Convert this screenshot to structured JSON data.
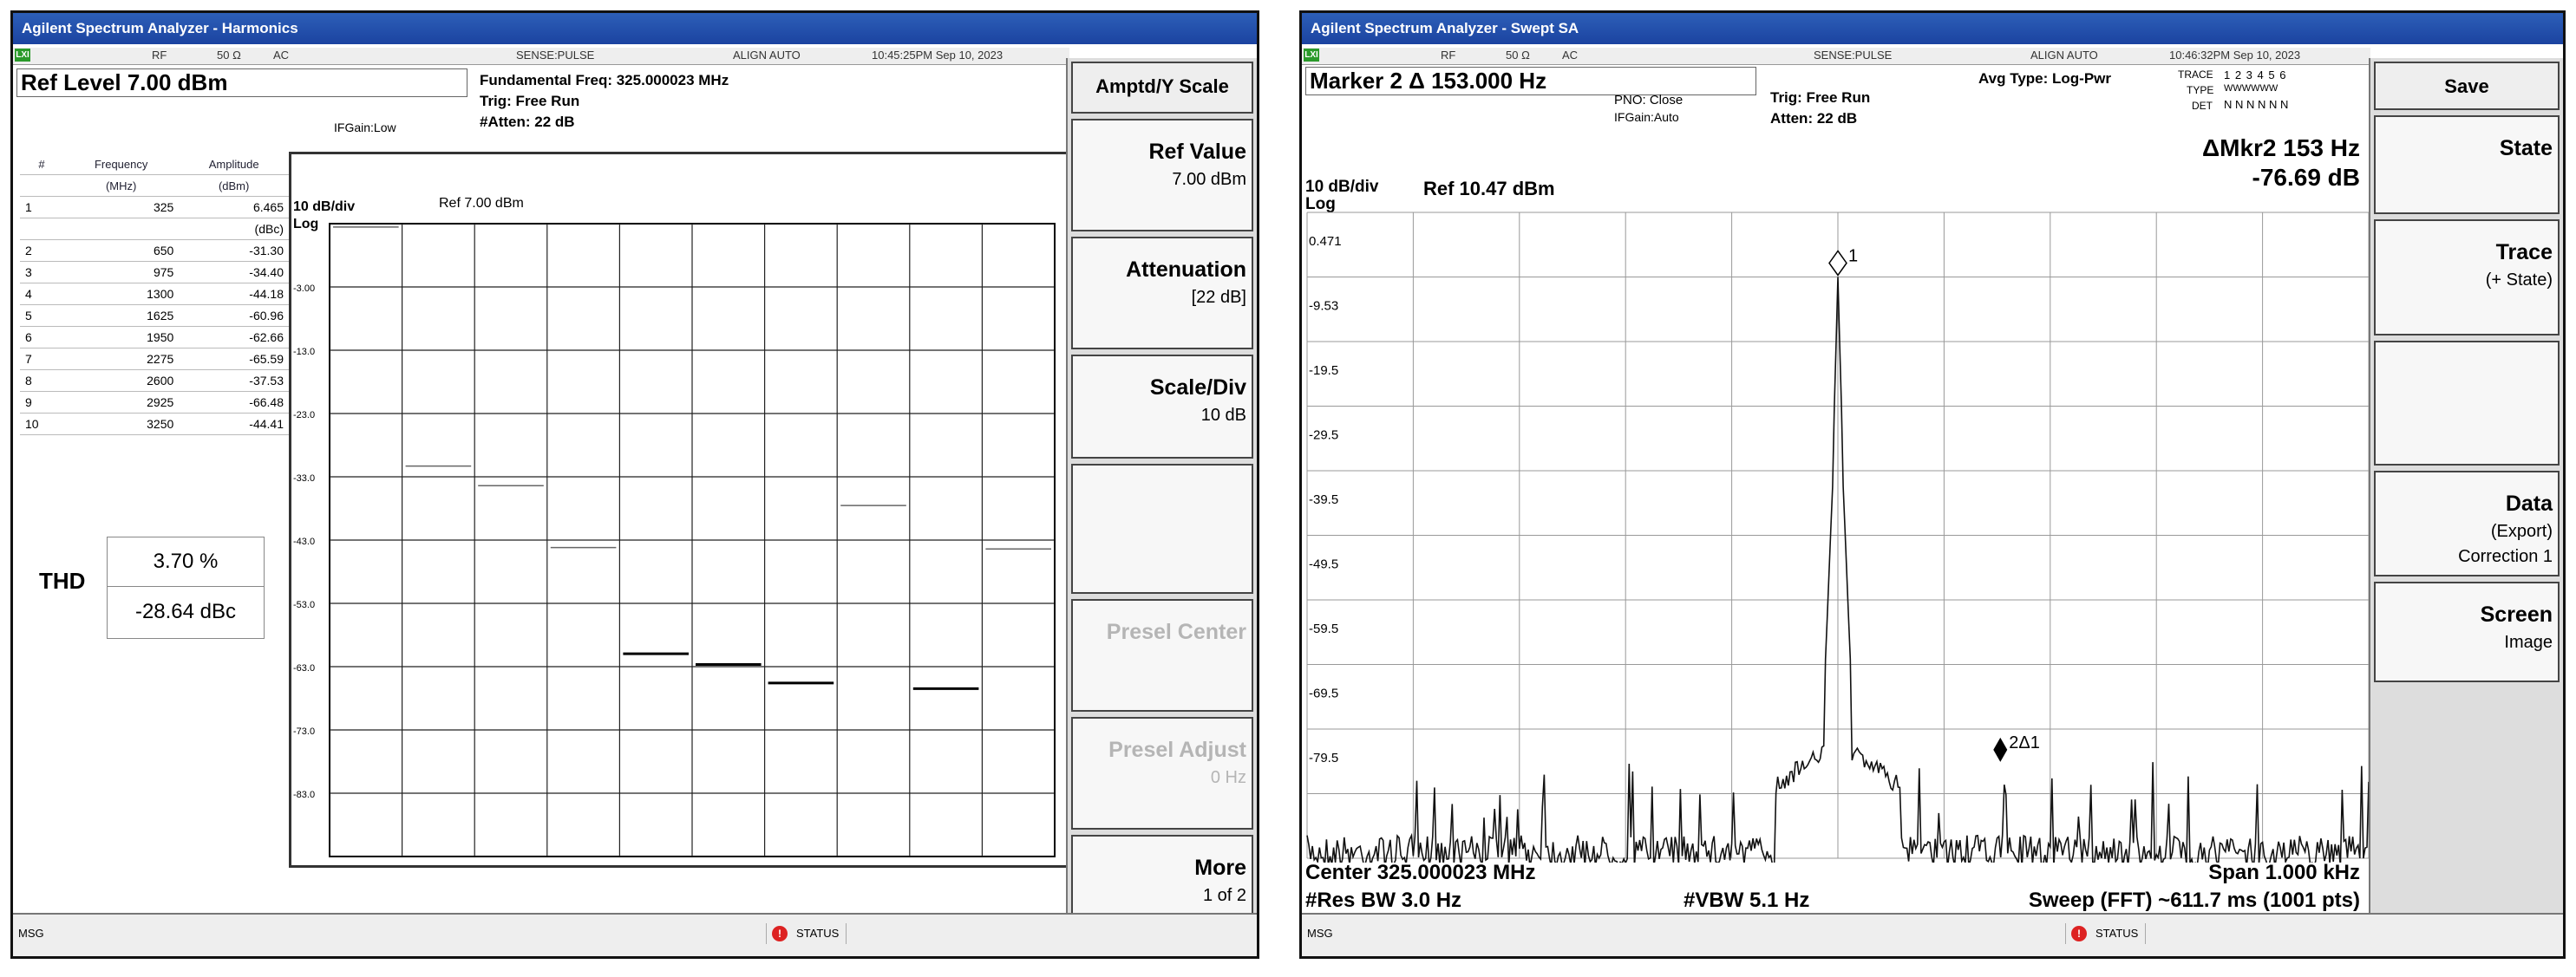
{
  "left": {
    "title": "Agilent Spectrum Analyzer - Harmonics",
    "status": {
      "lx": "LXI",
      "rf": "RF",
      "imp": "50 Ω",
      "coupling": "AC",
      "sense": "SENSE:PULSE",
      "align": "ALIGN AUTO",
      "time": "10:45:25PM Sep 10, 2023"
    },
    "ref_level": "Ref Level 7.00 dBm",
    "fund_freq": "Fundamental Freq: 325.000023 MHz",
    "trig": "Trig: Free Run",
    "atten": "#Atten: 22 dB",
    "ifgain": "IFGain:Low",
    "scale_div": "10 dB/div",
    "log": "Log",
    "ref_label": "Ref 7.00 dBm",
    "y_ticks": [
      "-3.00",
      "-13.0",
      "-23.0",
      "-33.0",
      "-43.0",
      "-53.0",
      "-63.0",
      "-73.0",
      "-83.0"
    ],
    "table": {
      "headers": [
        "#",
        "Frequency",
        "Amplitude"
      ],
      "subheaders": [
        "",
        "(MHz)",
        "(dBm)"
      ],
      "rows": [
        {
          "n": "1",
          "f": "325",
          "a": "6.465",
          "unit": "(dBc)"
        },
        {
          "n": "2",
          "f": "650",
          "a": "-31.30"
        },
        {
          "n": "3",
          "f": "975",
          "a": "-34.40"
        },
        {
          "n": "4",
          "f": "1300",
          "a": "-44.18"
        },
        {
          "n": "5",
          "f": "1625",
          "a": "-60.96"
        },
        {
          "n": "6",
          "f": "1950",
          "a": "-62.66"
        },
        {
          "n": "7",
          "f": "2275",
          "a": "-65.59"
        },
        {
          "n": "8",
          "f": "2600",
          "a": "-37.53"
        },
        {
          "n": "9",
          "f": "2925",
          "a": "-66.48"
        },
        {
          "n": "10",
          "f": "3250",
          "a": "-44.41"
        }
      ]
    },
    "thd": {
      "label": "THD",
      "percent": "3.70 %",
      "dbc": "-28.64 dBc"
    },
    "bars_dbm": [
      6.465,
      -31.3,
      -34.4,
      -44.18,
      -60.96,
      -62.66,
      -65.59,
      -37.53,
      -66.48,
      -44.41
    ],
    "softkeys": [
      {
        "title": "Amptd/Y Scale",
        "sub": "",
        "type": "head"
      },
      {
        "title": "Ref Value",
        "sub": "7.00 dBm"
      },
      {
        "title": "Attenuation",
        "sub": "[22 dB]"
      },
      {
        "title": "Scale/Div",
        "sub": "10 dB"
      },
      {
        "title": "",
        "sub": ""
      },
      {
        "title": "Presel Center",
        "sub": "",
        "type": "grey"
      },
      {
        "title": "Presel Adjust",
        "sub": "0 Hz",
        "type": "grey"
      },
      {
        "title": "More",
        "sub": "1 of 2"
      }
    ],
    "msg": "MSG",
    "status_btn": "STATUS"
  },
  "right": {
    "title": "Agilent Spectrum Analyzer - Swept SA",
    "status": {
      "lx": "LXI",
      "rf": "RF",
      "imp": "50 Ω",
      "coupling": "AC",
      "sense": "SENSE:PULSE",
      "align": "ALIGN AUTO",
      "time": "10:46:32PM Sep 10, 2023"
    },
    "marker": "Marker 2 Δ 153.000 Hz",
    "pno": "PNO: Close",
    "ifgain": "IFGain:Auto",
    "trig": "Trig: Free Run",
    "atten": "Atten: 22 dB",
    "avg_type": "Avg Type: Log-Pwr",
    "trace_lbl": "TRACE",
    "trace_vals": "1 2 3 4 5 6",
    "type_lbl": "TYPE",
    "type_vals": "WWWWWW",
    "det_lbl": "DET",
    "det_vals": "N N N N N N",
    "delta_mkr": "ΔMkr2 153 Hz",
    "delta_db": "-76.69 dB",
    "scale_div": "10 dB/div",
    "ref_label": "Ref 10.47 dBm",
    "log": "Log",
    "y_ticks": [
      "0.471",
      "-9.53",
      "-19.5",
      "-29.5",
      "-39.5",
      "-49.5",
      "-59.5",
      "-69.5",
      "-79.5"
    ],
    "center": "Center 325.000023 MHz",
    "span": "Span 1.000 kHz",
    "rbw": "#Res BW 3.0 Hz",
    "vbw": "#VBW 5.1 Hz",
    "sweep": "Sweep (FFT)  ~611.7 ms (1001 pts)",
    "marker1_label": "1",
    "marker2_label": "2Δ1",
    "softkeys": [
      {
        "title": "Save",
        "sub": "",
        "type": "head"
      },
      {
        "title": "State",
        "sub": ""
      },
      {
        "title": "Trace",
        "sub": "(+ State)"
      },
      {
        "title": "",
        "sub": ""
      },
      {
        "title": "Data",
        "sub": "(Export)",
        "sub2": "Correction 1"
      },
      {
        "title": "Screen",
        "sub": "Image"
      }
    ],
    "msg": "MSG",
    "status_btn": "STATUS"
  }
}
